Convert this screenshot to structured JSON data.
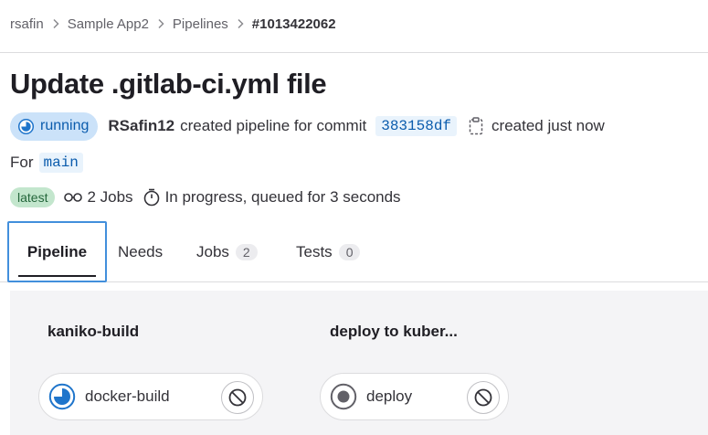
{
  "breadcrumb": {
    "items": [
      "rsafin",
      "Sample App2",
      "Pipelines",
      "#1013422062"
    ]
  },
  "pipeline": {
    "title": "Update .gitlab-ci.yml file",
    "status": "running",
    "author": "RSafin12",
    "action_text": "created pipeline for commit",
    "commit_sha": "383158df",
    "created_text": "created just now",
    "for_label": "For",
    "branch": "main",
    "latest_badge": "latest",
    "jobs_text": "2 Jobs",
    "progress_text": "In progress, queued for 3 seconds"
  },
  "tabs": [
    {
      "label": "Pipeline",
      "active": true
    },
    {
      "label": "Needs"
    },
    {
      "label": "Jobs",
      "count": "2"
    },
    {
      "label": "Tests",
      "count": "0"
    }
  ],
  "stages": [
    {
      "title": "kaniko-build",
      "job": {
        "name": "docker-build",
        "status_icon": "running-icon",
        "action_icon": "cancel-icon"
      }
    },
    {
      "title": "deploy to kuber...",
      "job": {
        "name": "deploy",
        "status_icon": "pending-icon",
        "action_icon": "cancel-icon"
      }
    }
  ],
  "colors": {
    "running_badge_bg": "#cbe2f9",
    "running_badge_text": "#0b5cad",
    "latest_badge_bg": "#c3e6cd",
    "latest_badge_text": "#24663b",
    "active_tab_focus": "#428fdc",
    "graph_bg": "#f4f4f6"
  }
}
